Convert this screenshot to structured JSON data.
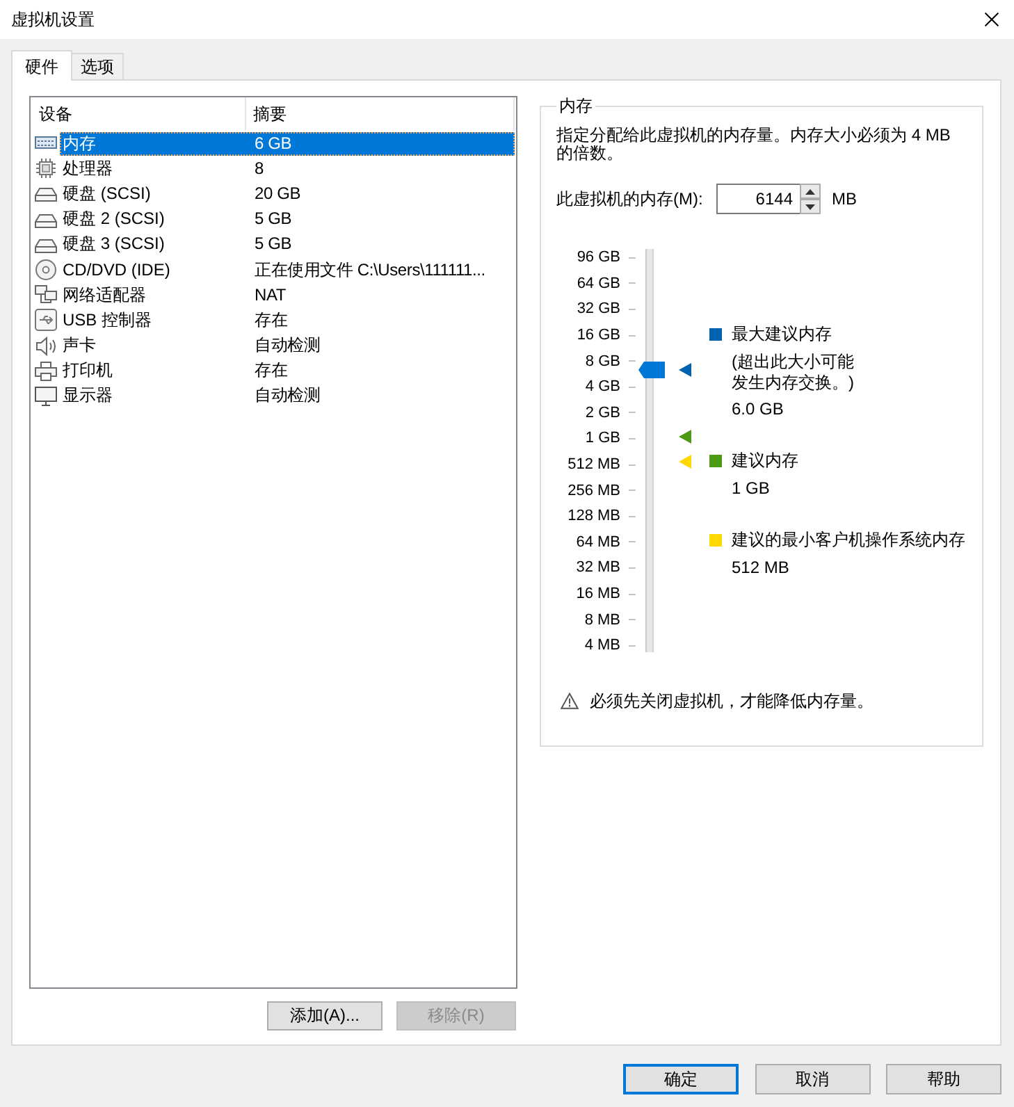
{
  "window": {
    "title": "虚拟机设置"
  },
  "tabs": [
    {
      "label": "硬件",
      "selected": true
    },
    {
      "label": "选项",
      "selected": false
    }
  ],
  "device_list": {
    "columns": [
      "设备",
      "摘要"
    ],
    "rows": [
      {
        "kind": "memory",
        "device": "内存",
        "summary": "6 GB",
        "selected": true
      },
      {
        "kind": "processor",
        "device": "处理器",
        "summary": "8",
        "selected": false
      },
      {
        "kind": "disk",
        "device": "硬盘 (SCSI)",
        "summary": "20 GB",
        "selected": false
      },
      {
        "kind": "disk",
        "device": "硬盘 2 (SCSI)",
        "summary": "5 GB",
        "selected": false
      },
      {
        "kind": "disk",
        "device": "硬盘 3 (SCSI)",
        "summary": "5 GB",
        "selected": false
      },
      {
        "kind": "cdrom",
        "device": "CD/DVD (IDE)",
        "summary": "正在使用文件 C:\\Users\\111111...",
        "selected": false
      },
      {
        "kind": "network",
        "device": "网络适配器",
        "summary": "NAT",
        "selected": false
      },
      {
        "kind": "usb",
        "device": "USB 控制器",
        "summary": "存在",
        "selected": false
      },
      {
        "kind": "sound",
        "device": "声卡",
        "summary": "自动检测",
        "selected": false
      },
      {
        "kind": "printer",
        "device": "打印机",
        "summary": "存在",
        "selected": false
      },
      {
        "kind": "display",
        "device": "显示器",
        "summary": "自动检测",
        "selected": false
      }
    ]
  },
  "list_buttons": [
    {
      "label": "添加(A)...",
      "disabled": false
    },
    {
      "label": "移除(R)",
      "disabled": true
    }
  ],
  "memory_panel": {
    "title": "内存",
    "description": "指定分配给此虚拟机的内存量。内存大小必须为 4 MB 的倍数。",
    "field_label": "此虚拟机的内存(M):",
    "value": "6144",
    "unit": "MB",
    "scale": [
      "96 GB",
      "64 GB",
      "32 GB",
      "16 GB",
      "8 GB",
      "4 GB",
      "2 GB",
      "1 GB",
      "512 MB",
      "256 MB",
      "128 MB",
      "64 MB",
      "32 MB",
      "16 MB",
      "8 MB",
      "4 MB"
    ],
    "slider": {
      "level": 0.7,
      "markers": [
        {
          "color": "#0063b1",
          "level": 0.7
        },
        {
          "color": "#4d9a14",
          "level": 0.534
        },
        {
          "color": "#ffd800",
          "level": 0.472
        }
      ]
    },
    "legend": [
      {
        "label": "最大建议内存",
        "note": "(超出此大小可能发生内存交换。)",
        "value": "6.0 GB",
        "color": "#0063b1"
      },
      {
        "label": "建议内存",
        "value": "1 GB",
        "color": "#4d9a14"
      },
      {
        "label": "建议的最小客户机操作系统内存",
        "value": "512 MB",
        "color": "#ffd800"
      }
    ],
    "warning": "必须先关闭虚拟机，才能降低内存量。"
  },
  "dialog_buttons": [
    {
      "label": "确定",
      "default": true
    },
    {
      "label": "取消",
      "default": false
    },
    {
      "label": "帮助",
      "default": false
    }
  ]
}
